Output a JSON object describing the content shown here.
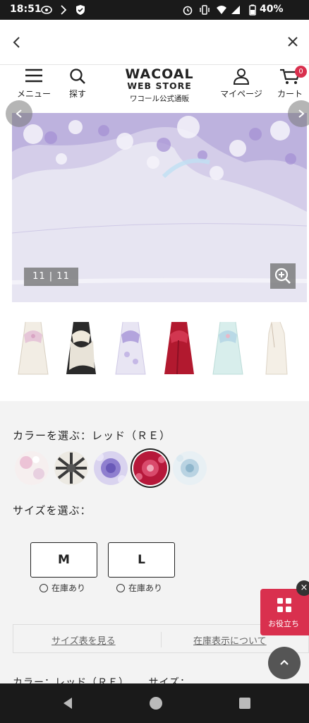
{
  "status_bar": {
    "time": "18:51",
    "battery": "40%"
  },
  "header": {
    "menu_label": "メニュー",
    "search_label": "探す",
    "logo_line1": "WACOAL",
    "logo_line2": "WEB STORE",
    "logo_line3": "ワコール公式通販",
    "mypage_label": "マイページ",
    "cart_label": "カート",
    "cart_count": "0"
  },
  "gallery": {
    "counter": "11 | 11",
    "thumbnail_count": 6
  },
  "color": {
    "title": "カラーを選ぶ：レッド（ＲＥ）",
    "swatches": [
      "white-floral",
      "black-floral",
      "purple-floral",
      "red-floral",
      "blue-floral"
    ],
    "selected": "red-floral"
  },
  "size": {
    "title": "サイズを選ぶ：",
    "options": [
      {
        "label": "M",
        "stock": "在庫あり"
      },
      {
        "label": "L",
        "stock": "在庫あり"
      }
    ]
  },
  "links": {
    "size_chart": "サイズ表を見る",
    "stock_info": "在庫表示について"
  },
  "summary": {
    "color_label": "カラー：レッド（ＲＥ）",
    "size_label": "サイズ："
  },
  "floating": {
    "helpful_label": "お役立ち",
    "close_label": "×"
  },
  "colors": {
    "accent": "#d9304e",
    "gray_bg": "#f3f3f3"
  }
}
